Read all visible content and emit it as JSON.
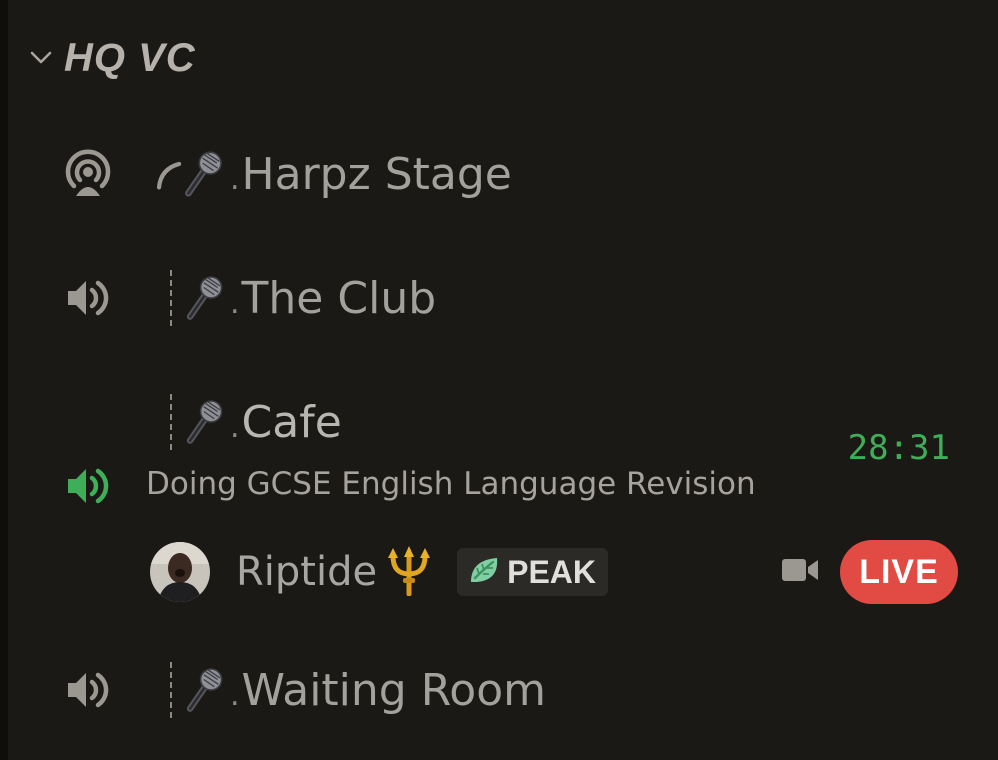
{
  "category": {
    "title": "HQ VC",
    "icon": "chevron-down-icon"
  },
  "channels": [
    {
      "icon": "stage-icon",
      "prefix": "curve",
      "emoji": "microphone",
      "name": "Harpz Stage",
      "active": false
    },
    {
      "icon": "speaker-icon",
      "prefix": "dotted",
      "emoji": "microphone",
      "name": "The Club",
      "active": false
    },
    {
      "icon": "speaker-icon",
      "prefix": "dotted",
      "emoji": "microphone",
      "name": "Cafe",
      "active": true
    },
    {
      "icon": "speaker-icon",
      "prefix": "dotted",
      "emoji": "microphone",
      "name": "Waiting Room",
      "active": false
    }
  ],
  "active_channel": {
    "timer": "28:31",
    "status": "Doing GCSE English Language Revision",
    "user": {
      "name": "Riptide",
      "emoji": "trident",
      "tag": "PEAK",
      "tag_icon": "leaf-icon",
      "camera_icon": "video-camera-icon",
      "live_label": "LIVE"
    }
  },
  "colors": {
    "background": "#1b1916",
    "text_muted": "#a3a19c",
    "active_green": "#3fae58",
    "live_red": "#e24a44"
  }
}
